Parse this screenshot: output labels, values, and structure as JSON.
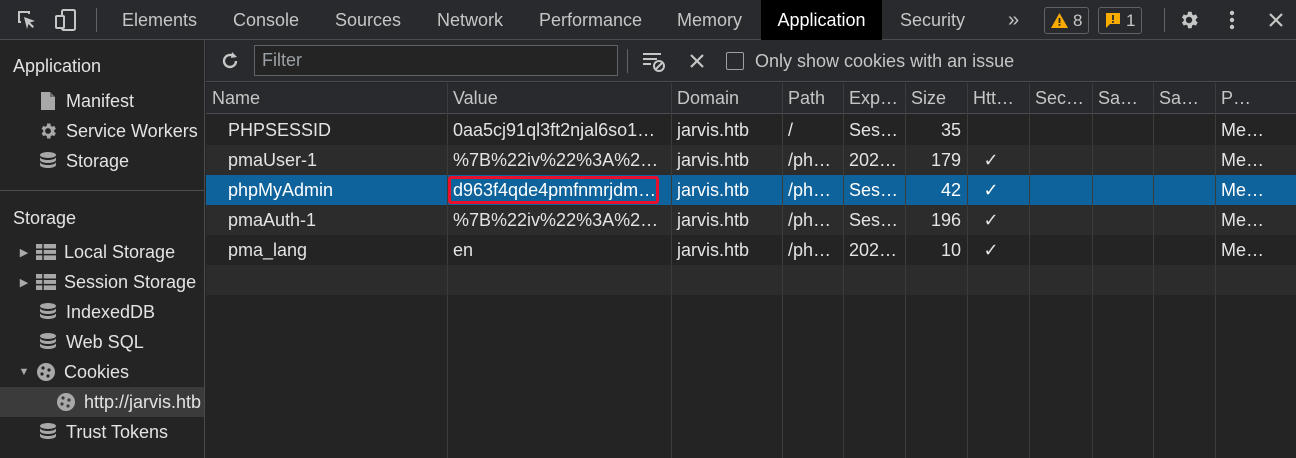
{
  "colors": {
    "accent": "#0e639c",
    "highlight": "#e8112d",
    "warning": "#f9ab00"
  },
  "topbar": {
    "tabs": [
      "Elements",
      "Console",
      "Sources",
      "Network",
      "Performance",
      "Memory",
      "Application",
      "Security"
    ],
    "active_tab": "Application",
    "more": "»",
    "warnings_count": "8",
    "errors_count": "1"
  },
  "sidebar": {
    "application_header": "Application",
    "application_items": [
      {
        "label": "Manifest",
        "icon": "file-icon"
      },
      {
        "label": "Service Workers",
        "icon": "gear-icon"
      },
      {
        "label": "Storage",
        "icon": "database-icon"
      }
    ],
    "storage_header": "Storage",
    "storage_items": [
      {
        "label": "Local Storage",
        "icon": "grid-icon",
        "expander": "▶"
      },
      {
        "label": "Session Storage",
        "icon": "grid-icon",
        "expander": "▶"
      },
      {
        "label": "IndexedDB",
        "icon": "database-icon"
      },
      {
        "label": "Web SQL",
        "icon": "database-icon"
      },
      {
        "label": "Cookies",
        "icon": "cookie-icon",
        "expander": "▼"
      },
      {
        "label": "http://jarvis.htb",
        "icon": "cookie-icon",
        "selected": true
      },
      {
        "label": "Trust Tokens",
        "icon": "database-icon"
      }
    ]
  },
  "toolbar": {
    "filter_placeholder": "Filter",
    "only_issues_label": "Only show cookies with an issue"
  },
  "table": {
    "columns": [
      "Name",
      "Value",
      "Domain",
      "Path",
      "Exp…",
      "Size",
      "Htt…",
      "Sec…",
      "Sa…",
      "Sa…",
      "P…"
    ],
    "rows": [
      [
        "PHPSESSID",
        "0aa5cj91ql3ft2njal6so1…",
        "jarvis.htb",
        "/",
        "Ses…",
        "35",
        "",
        "",
        "",
        "",
        "Me…"
      ],
      [
        "pmaUser-1",
        "%7B%22iv%22%3A%2…",
        "jarvis.htb",
        "/ph…",
        "202…",
        "179",
        "✓",
        "",
        "",
        "",
        "Me…"
      ],
      [
        "phpMyAdmin",
        "d963f4qde4pmfnmrjdm…",
        "jarvis.htb",
        "/ph…",
        "Ses…",
        "42",
        "✓",
        "",
        "",
        "",
        "Me…"
      ],
      [
        "pmaAuth-1",
        "%7B%22iv%22%3A%2…",
        "jarvis.htb",
        "/ph…",
        "Ses…",
        "196",
        "✓",
        "",
        "",
        "",
        "Me…"
      ],
      [
        "pma_lang",
        "en",
        "jarvis.htb",
        "/ph…",
        "202…",
        "10",
        "✓",
        "",
        "",
        "",
        "Me…"
      ]
    ],
    "selected_row": 2
  }
}
